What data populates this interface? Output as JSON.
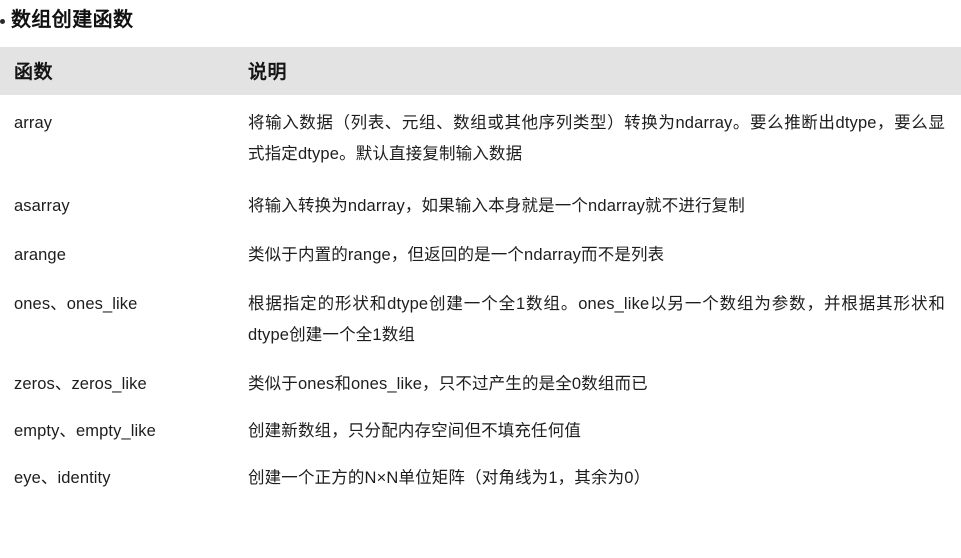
{
  "page": {
    "title": "数组创建函数",
    "bullet": "bullet-marker"
  },
  "table": {
    "headers": {
      "function": "函数",
      "description": "说明"
    },
    "header_background": "#e3e3e3",
    "rows": [
      {
        "function": "array",
        "description": "将输入数据（列表、元组、数组或其他序列类型）转换为ndarray。要么推断出dtype，要么显式指定dtype。默认直接复制输入数据"
      },
      {
        "function": "asarray",
        "description": "将输入转换为ndarray，如果输入本身就是一个ndarray就不进行复制"
      },
      {
        "function": "arange",
        "description": "类似于内置的range，但返回的是一个ndarray而不是列表"
      },
      {
        "function": "ones、ones_like",
        "description": "根据指定的形状和dtype创建一个全1数组。ones_like以另一个数组为参数，并根据其形状和dtype创建一个全1数组"
      },
      {
        "function": "zeros、zeros_like",
        "description": "类似于ones和ones_like，只不过产生的是全0数组而已"
      },
      {
        "function": "empty、empty_like",
        "description": "创建新数组，只分配内存空间但不填充任何值"
      },
      {
        "function": "eye、identity",
        "description": "创建一个正方的N×N单位矩阵（对角线为1，其余为0）"
      }
    ]
  }
}
